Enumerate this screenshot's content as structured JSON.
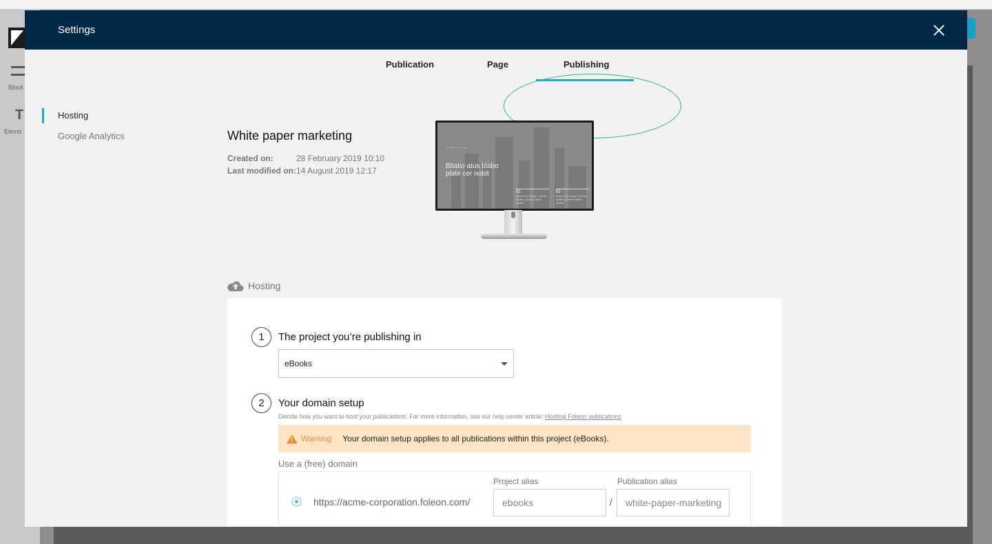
{
  "background": {
    "block_label": "Block",
    "element_icon": "T",
    "element_label": "Eleme"
  },
  "modal": {
    "title": "Settings"
  },
  "tabs": [
    {
      "label": "Publication"
    },
    {
      "label": "Page"
    },
    {
      "label": "Publishing",
      "active": true
    }
  ],
  "side_nav": [
    {
      "label": "Hosting",
      "active": true
    },
    {
      "label": "Google Analytics",
      "active": false
    }
  ],
  "publication": {
    "title": "White paper marketing",
    "created_label": "Created on:",
    "created_value": "28 February 2019 10:10",
    "modified_label": "Last modified on:",
    "modified_value": "14 August 2019 12:17"
  },
  "preview": {
    "headline": "Bitatio atus blabo plate cer nobit",
    "col1_num": "01",
    "col1_text": "Nonre me veniqu vedi pa ipsidis, pi bue hollect errolis",
    "col2_num": "02",
    "col2_text": "Nonre me veniqu vedi pa ipsidis, pi bue hollect errolis"
  },
  "hosting": {
    "heading": "Hosting",
    "step1_num": "1",
    "step1_label": "The project you’re publishing in",
    "project_value": "eBooks",
    "step2_num": "2",
    "step2_label": "Your domain setup",
    "help_text": "Decide how you want to host your publications. For more information, see our help center article:",
    "help_link": "Hosting Foleon publications",
    "warning_label": "Warning",
    "warning_text": "Your domain setup applies to all publications within this project (eBooks).",
    "free_domain_label": "Use a (free) domain",
    "domain_url": "https://acme-corporation.foleon.com/",
    "project_alias_label": "Project alias",
    "project_alias_value": "ebooks",
    "slash": "/",
    "publication_alias_label": "Publication alias",
    "publication_alias_value": "white-paper-marketing"
  },
  "colors": {
    "header": "#002947",
    "accent": "#21a6d3",
    "warning": "#f0902b",
    "annotation": "#1fb88e"
  }
}
